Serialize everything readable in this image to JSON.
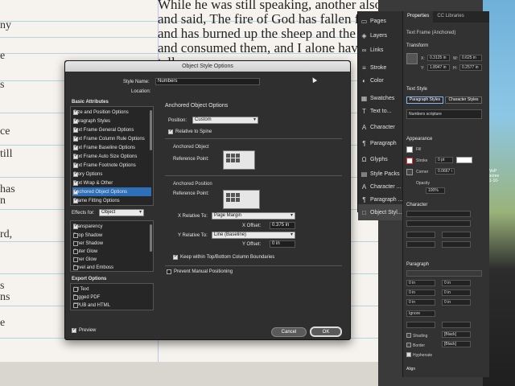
{
  "document": {
    "lines": [
      "While he was still speaking, another also c",
      "and said, The fire of God has fallen from the",
      "and has burned up the sheep and the servan",
      "and consumed them, and I alone have escap",
      "tell you."
    ],
    "left_fragments": [
      "ny",
      "e",
      "s",
      "ce",
      "till",
      "has",
      "n",
      "rd,",
      "s",
      "ns",
      "e"
    ]
  },
  "desktop": {
    "labels": [
      "VoP",
      "scree",
      "1-10-"
    ]
  },
  "tabstrip": {
    "items": [
      {
        "label": "Pages",
        "icon": "pages-icon",
        "glyph": "▭"
      },
      {
        "label": "Layers",
        "icon": "layers-icon",
        "glyph": "◈"
      },
      {
        "label": "Links",
        "icon": "links-icon",
        "glyph": "∞"
      },
      {
        "label": "Stroke",
        "icon": "stroke-icon",
        "glyph": "≡"
      },
      {
        "label": "Color",
        "icon": "color-icon",
        "glyph": "◐"
      },
      {
        "label": "Swatches",
        "icon": "swatches-icon",
        "glyph": "▦"
      },
      {
        "label": "Text to...",
        "icon": "text-icon",
        "glyph": "T"
      },
      {
        "label": "Character",
        "icon": "character-icon",
        "glyph": "A"
      },
      {
        "label": "Paragraph",
        "icon": "paragraph-icon",
        "glyph": "¶"
      },
      {
        "label": "Glyphs",
        "icon": "glyphs-icon",
        "glyph": "Ω"
      },
      {
        "label": "Style Packs",
        "icon": "style-packs-icon",
        "glyph": "▤"
      },
      {
        "label": "Character ...",
        "icon": "character-styles-icon",
        "glyph": "A"
      },
      {
        "label": "Paragraph ...",
        "icon": "paragraph-styles-icon",
        "glyph": "¶"
      },
      {
        "label": "Object Styl...",
        "icon": "object-styles-icon",
        "glyph": "□"
      }
    ]
  },
  "properties": {
    "tabs": [
      "Properties",
      "CC Libraries"
    ],
    "selection": "Text Frame (Anchored)",
    "transform_title": "Transform",
    "x_label": "X:",
    "x_value": "0.3125 in",
    "y_label": "Y:",
    "y_value": "1.8947 in",
    "w_label": "W:",
    "w_value": "0.625 in",
    "h_label": "H:",
    "h_value": "0.2577 in",
    "text_style_title": "Text Style",
    "paragraph_styles": "Paragraph Styles",
    "character_styles": "Character Styles",
    "style_value": "Numbers scripture",
    "appearance_title": "Appearance",
    "fill_label": "Fill",
    "stroke_label": "Stroke",
    "stroke_value": "0 pt",
    "corner_label": "Corner",
    "corner_value": "0.0667 i",
    "opacity_label": "Opacity",
    "opacity_value": "100%",
    "character_title": "Character",
    "paragraph_title": "Paragraph",
    "para_fields": [
      "0 in",
      "0 in",
      "0 in",
      "0 in",
      "0 in",
      "0 in"
    ],
    "ignore_label": "Ignore",
    "shading_label": "Shading",
    "border_label": "Border",
    "hyphenate_label": "Hyphenate",
    "black_label": "[Black]",
    "align_label": "Align"
  },
  "dialog": {
    "title": "Object Style Options",
    "style_name_label": "Style Name:",
    "style_name_value": "Numbers",
    "location_label": "Location:",
    "basic_attributes_title": "Basic Attributes",
    "basic_attributes": [
      {
        "label": "Size and Position Options",
        "checked": true
      },
      {
        "label": "Paragraph Styles",
        "checked": true
      },
      {
        "label": "Text Frame General Options",
        "checked": true
      },
      {
        "label": "Text Frame Column Rule Options",
        "checked": true
      },
      {
        "label": "Text Frame Baseline Options",
        "checked": true
      },
      {
        "label": "Text Frame Auto Size Options",
        "checked": true
      },
      {
        "label": "Text Frame Footnote Options",
        "checked": true
      },
      {
        "label": "Story Options",
        "checked": true
      },
      {
        "label": "Text Wrap & Other",
        "checked": true
      },
      {
        "label": "Anchored Object Options",
        "checked": true,
        "selected": true
      },
      {
        "label": "Frame Fitting Options",
        "checked": true
      }
    ],
    "effects_for_label": "Effects for:",
    "effects_for_value": "Object",
    "effects": [
      {
        "label": "Transparency",
        "checked": true
      },
      {
        "label": "Drop Shadow",
        "checked": false
      },
      {
        "label": "Inner Shadow",
        "checked": false
      },
      {
        "label": "Outer Glow",
        "checked": false
      },
      {
        "label": "Inner Glow",
        "checked": false
      },
      {
        "label": "Bevel and Emboss",
        "checked": false
      }
    ],
    "export_title": "Export Options",
    "export": [
      "Alt Text",
      "Tagged PDF",
      "EPUB and HTML"
    ],
    "preview_label": "Preview",
    "panel_title": "Anchored Object Options",
    "position_label": "Position:",
    "position_value": "Custom",
    "relative_spine_label": "Relative to Spine",
    "anchored_object_title": "Anchored Object",
    "reference_point_label": "Reference Point:",
    "anchored_position_title": "Anchored Position",
    "x_relative_label": "X Relative To:",
    "x_relative_value": "Page Margin",
    "x_offset_label": "X Offset:",
    "x_offset_value": "0.375 in",
    "y_relative_label": "Y Relative To:",
    "y_relative_value": "Line (Baseline)",
    "y_offset_label": "Y Offset:",
    "y_offset_value": "0 in",
    "keep_within_label": "Keep within Top/Bottom Column Boundaries",
    "prevent_manual_label": "Prevent Manual Positioning",
    "cancel_label": "Cancel",
    "ok_label": "OK"
  }
}
